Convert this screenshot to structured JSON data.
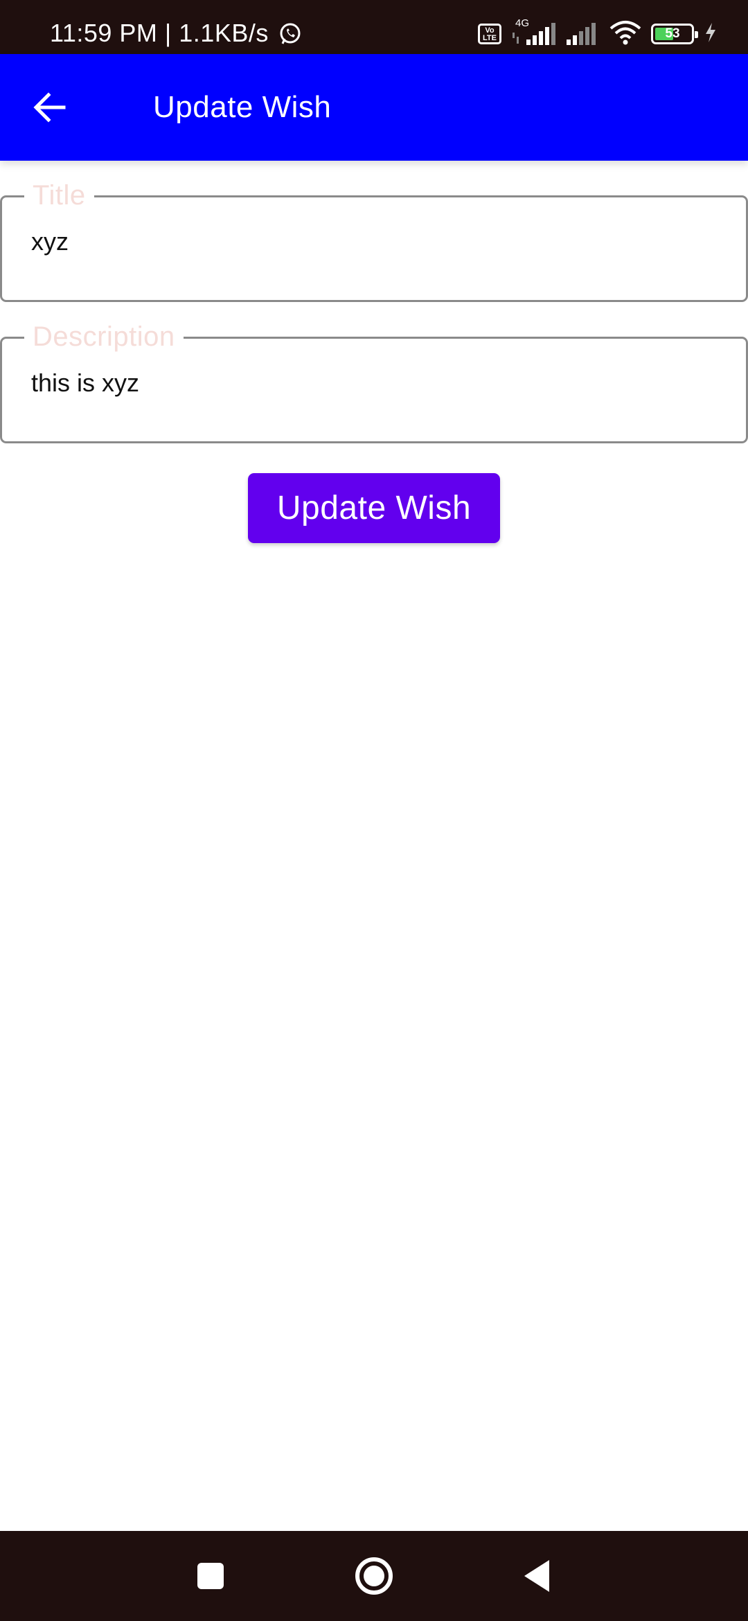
{
  "status_bar": {
    "time": "11:59 PM | 1.1KB/s",
    "network_type": "4G",
    "volte": "Vo LTE",
    "battery_level": "53",
    "icons": [
      "whatsapp-icon",
      "volte-icon",
      "signal-icon",
      "wifi-icon",
      "battery-icon",
      "charging-icon"
    ]
  },
  "app_bar": {
    "title": "Update Wish",
    "back_icon": "arrow-left-icon"
  },
  "form": {
    "title_label": "Title",
    "title_value": "xyz",
    "description_label": "Description",
    "description_value": "this is xyz",
    "submit_label": "Update Wish"
  },
  "nav_bar": {
    "icons": [
      "recent-apps-icon",
      "home-icon",
      "back-icon"
    ]
  },
  "colors": {
    "app_bar": "#0000ff",
    "button": "#6200ee",
    "system_bars": "#1f0f0e",
    "field_label": "#f5dcd8"
  }
}
